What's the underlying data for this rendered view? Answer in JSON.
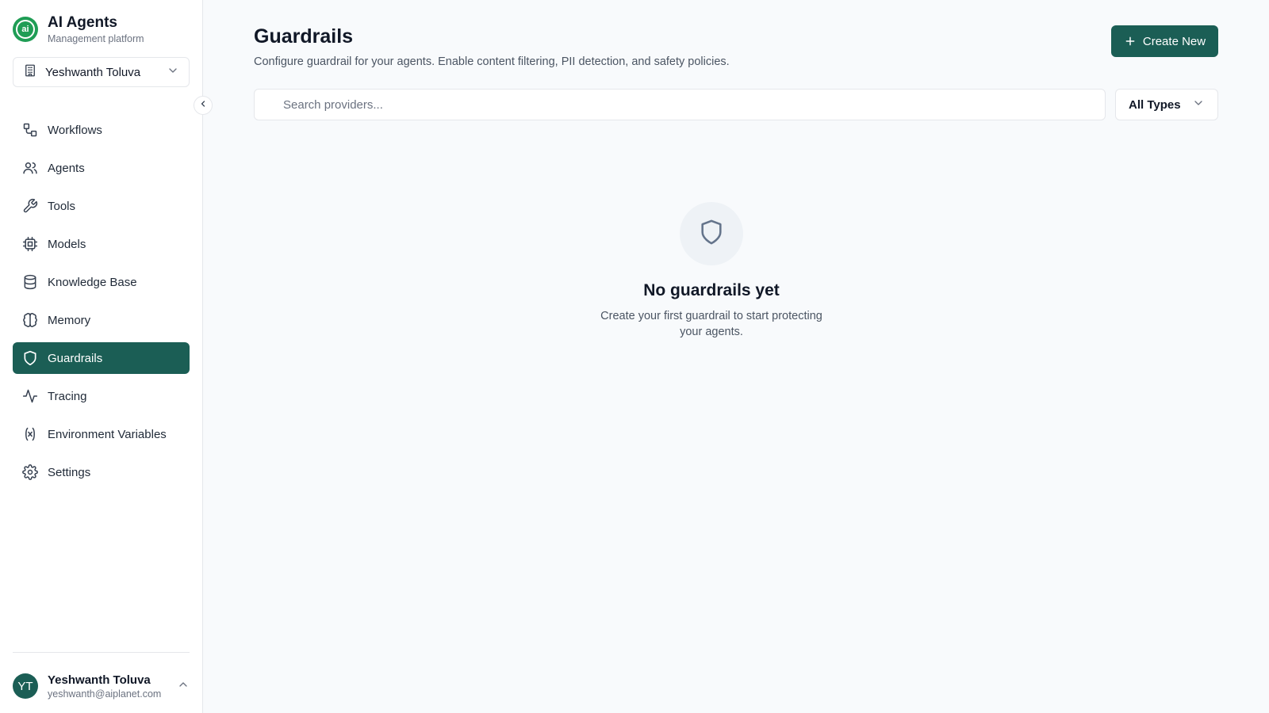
{
  "brand": {
    "title": "AI Agents",
    "subtitle": "Management platform",
    "logo_text": "ai"
  },
  "org": {
    "name": "Yeshwanth Toluva"
  },
  "nav": {
    "items": [
      {
        "label": "Workflows"
      },
      {
        "label": "Agents"
      },
      {
        "label": "Tools"
      },
      {
        "label": "Models"
      },
      {
        "label": "Knowledge Base"
      },
      {
        "label": "Memory"
      },
      {
        "label": "Guardrails",
        "active": true
      },
      {
        "label": "Tracing"
      },
      {
        "label": "Environment Variables"
      },
      {
        "label": "Settings"
      }
    ]
  },
  "user": {
    "initials": "YT",
    "name": "Yeshwanth Toluva",
    "email": "yeshwanth@aiplanet.com"
  },
  "page": {
    "title": "Guardrails",
    "description": "Configure guardrail for your agents. Enable content filtering, PII detection, and safety policies.",
    "create_label": "Create New"
  },
  "search": {
    "placeholder": "Search providers...",
    "value": ""
  },
  "filter": {
    "selected": "All Types"
  },
  "empty_state": {
    "title": "No guardrails yet",
    "description": "Create your first guardrail to start protecting your agents."
  },
  "colors": {
    "accent": "#1b5e55",
    "logo": "#1f9d55"
  }
}
